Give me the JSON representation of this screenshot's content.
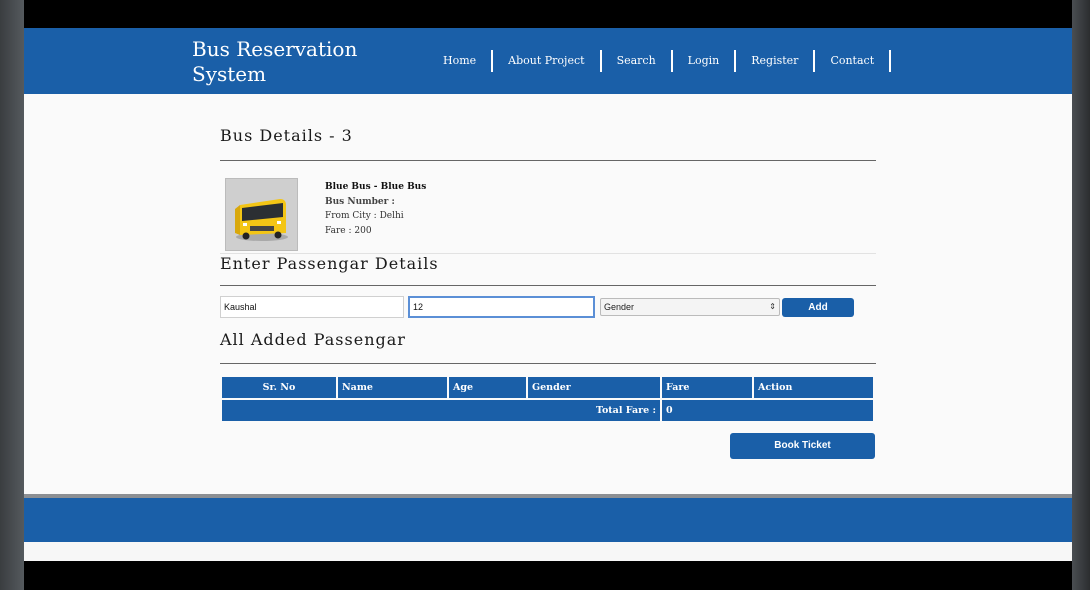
{
  "header": {
    "brand_line1": "Bus Reservation",
    "brand_line2": "System",
    "nav": [
      "Home",
      "About Project",
      "Search",
      "Login",
      "Register",
      "Contact"
    ]
  },
  "bus": {
    "section_title": "Bus Details - 3",
    "name": "Blue Bus - Blue Bus",
    "number_label": "Bus Number :",
    "from_city": "From City : Delhi",
    "fare": "Fare : 200",
    "image_icon": "bus-image"
  },
  "passenger_form": {
    "section_title": "Enter Passengar Details",
    "name_value": "Kaushal",
    "age_value": "12",
    "gender_selected": "Gender",
    "add_label": "Add"
  },
  "added": {
    "section_title": "All Added Passengar",
    "columns": [
      "Sr. No",
      "Name",
      "Age",
      "Gender",
      "Fare",
      "Action"
    ],
    "total_label": "Total Fare :",
    "total_value": "0"
  },
  "book_label": "Book Ticket",
  "colors": {
    "primary": "#1a5fa8",
    "background": "#fafafa"
  }
}
